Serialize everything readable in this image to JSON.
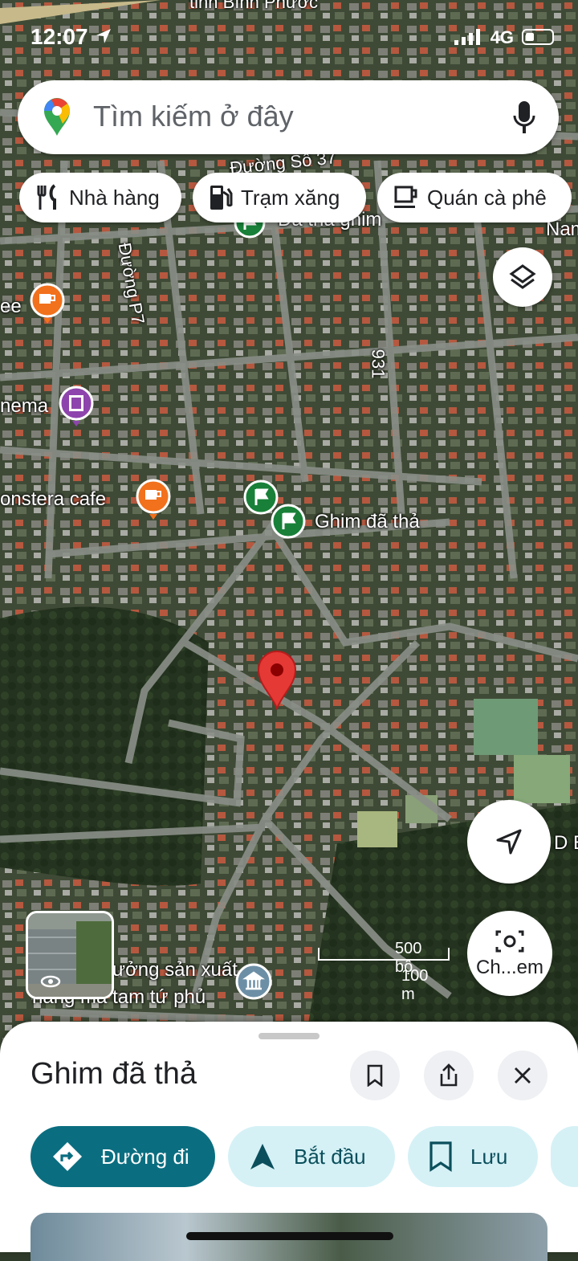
{
  "status_bar": {
    "time": "12:07",
    "network": "4G"
  },
  "search": {
    "placeholder": "Tìm kiếm ở đây"
  },
  "chips": [
    {
      "label": "Nhà hàng",
      "icon": "restaurant-icon"
    },
    {
      "label": "Trạm xăng",
      "icon": "gas-station-icon"
    },
    {
      "label": "Quán cà phê",
      "icon": "coffee-icon"
    }
  ],
  "map_labels": {
    "top_place": "tỉnh Bình Phước",
    "street_so37": "Đường Số 37",
    "street_p7": "Đường P7",
    "road_931": "931",
    "edge_nam": "Nam",
    "pin_label_top": "Đã thả ghim",
    "pin_label_main": "Ghim đã thả",
    "poi_coffee_left": "ee",
    "poi_cinema": "nema",
    "poi_monstera": "onstera cafe",
    "edge_b": "D Bì",
    "bottom_place_line1": "ưởng sản xuất",
    "bottom_place_line2": "hàng mã tam tứ phủ"
  },
  "scale": {
    "imperial": "500 bộ",
    "metric": "100 m"
  },
  "lens": {
    "label": "Ch...em"
  },
  "sheet": {
    "title": "Ghim đã thả",
    "actions": [
      {
        "label": "Đường đi",
        "icon": "directions-icon",
        "primary": true
      },
      {
        "label": "Bắt đầu",
        "icon": "navigation-icon",
        "primary": false
      },
      {
        "label": "Lưu",
        "icon": "bookmark-icon",
        "primary": false
      }
    ]
  },
  "colors": {
    "primary": "#0b6e80",
    "secondary_bg": "#d5f1f6",
    "pin_red": "#e53935",
    "flag_green": "#188038",
    "coffee_orange": "#f2711c",
    "cinema_purple": "#8e44ad"
  }
}
